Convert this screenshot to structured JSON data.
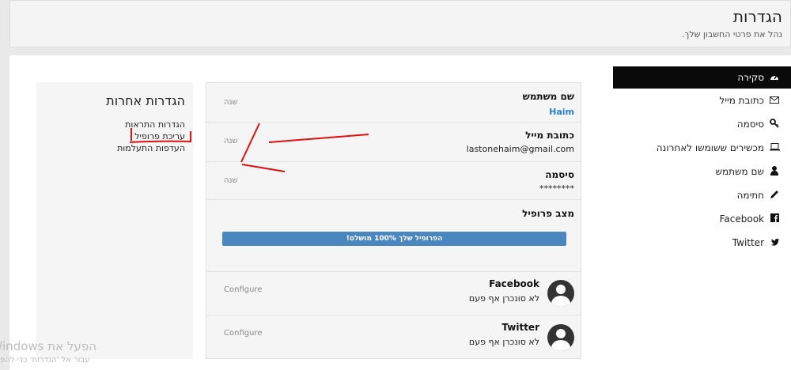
{
  "header": {
    "title": "הגדרות",
    "subtitle": "נהל את פרטי החשבון שלך."
  },
  "menu": {
    "items": [
      {
        "label": "סקירה",
        "icon": "dashboard-icon",
        "active": true
      },
      {
        "label": "כתובת מייל",
        "icon": "envelope-icon"
      },
      {
        "label": "סיסמה",
        "icon": "key-icon"
      },
      {
        "label": "מכשירים ששומשו לאחרונה",
        "icon": "laptop-icon"
      },
      {
        "label": "שם משתמש",
        "icon": "user-icon"
      },
      {
        "label": "חתימה",
        "icon": "pencil-icon"
      },
      {
        "label": "Facebook",
        "icon": "facebook-icon"
      },
      {
        "label": "Twitter",
        "icon": "twitter-icon"
      }
    ]
  },
  "account": {
    "username_label": "שם משתמש",
    "username_value": "Haim",
    "email_label": "כתובת מייל",
    "email_value": "lastonehaim@gmail.com",
    "password_label": "סיסמה",
    "password_value": "********",
    "change_label": "שנה"
  },
  "profile": {
    "label": "מצב פרופיל",
    "progress_text": "הפרופיל שלך 100% מושלם!",
    "progress": 1.0
  },
  "social": {
    "facebook": {
      "name": "Facebook",
      "status": "לא סונכרן אף פעם",
      "action": "Configure"
    },
    "twitter": {
      "name": "Twitter",
      "status": "לא סונכרן אף פעם",
      "action": "Configure"
    }
  },
  "other": {
    "title": "הגדרות אחרות",
    "links": [
      "הגדרות התראות",
      "עריכת פרופיל",
      "העדפות התעלמות"
    ]
  },
  "watermark": {
    "line1": "הפעל את Windows",
    "line2": "עבור אל 'הגדרות' כדי להפ"
  },
  "colors": {
    "accent": "#4a87c0",
    "annotation": "#e01010",
    "link": "#2a7fd4"
  }
}
